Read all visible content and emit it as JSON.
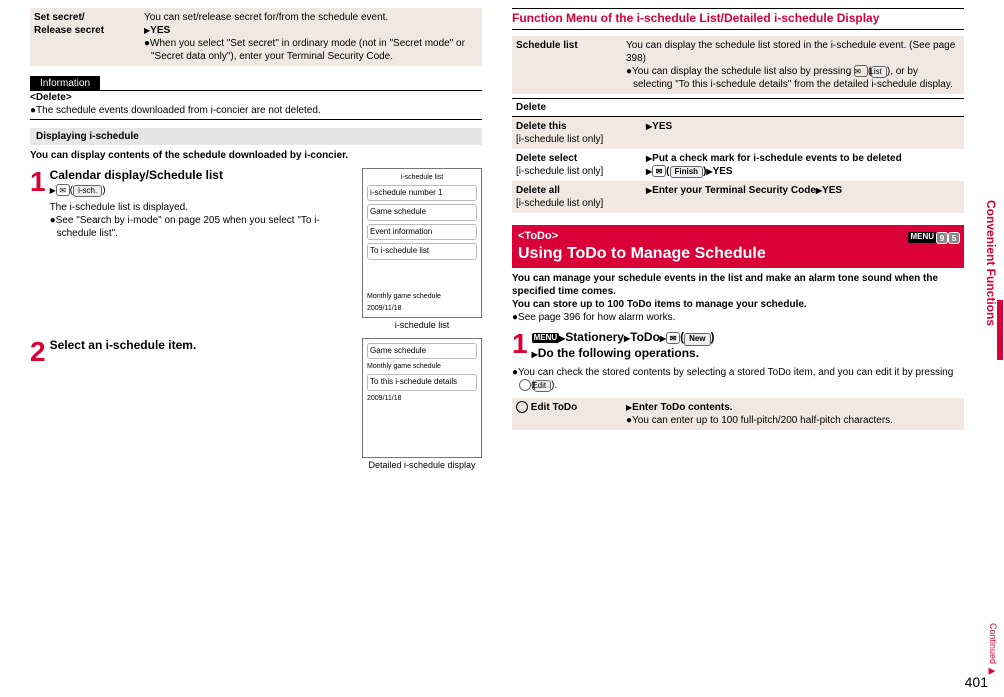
{
  "left": {
    "setSecret": {
      "label": "Set secret/\nRelease secret",
      "line1": "You can set/release secret for/from the schedule event.",
      "yes": "YES",
      "line2": "When you select \"Set secret\" in ordinary mode (not in \"Secret mode\" or \"Secret data only\"), enter your Terminal Security Code."
    },
    "infoLabel": "Information",
    "deleteHead": "<Delete>",
    "deleteBody": "The schedule events downloaded from i-concier are not deleted.",
    "dispHead": "Displaying i-schedule",
    "dispIntro": "You can display contents of the schedule downloaded by i-concier.",
    "step1": {
      "title": "Calendar display/Schedule list",
      "iconBtn": "i-sch.",
      "l1": "The i-schedule list is displayed.",
      "l2": "See \"Search by i-mode\" on page 205 when you select \"To i-schedule list\"."
    },
    "phone1": {
      "title": "i-schedule list",
      "r1": "i-schedule number 1",
      "r2": "Game schedule",
      "r3": "Event information",
      "r4": "To i-schedule list",
      "r5": "Monthly game schedule",
      "r6": "2009/11/18"
    },
    "step2": {
      "title": "Select an i-schedule item."
    },
    "phone2": {
      "title": "Detailed i-schedule display",
      "r1": "Game schedule",
      "r2": "Monthly game schedule",
      "r3": "To this i-schedule details",
      "r4": "2009/11/18"
    }
  },
  "right": {
    "funcHead": "Function Menu of the i-schedule List/Detailed i-schedule Display",
    "schedList": {
      "label": "Schedule list",
      "l1": "You can display the schedule list stored in the i-schedule event. (See page 398)",
      "l2": "You can display the schedule list also by pressing",
      "btn": "List",
      "l3": ", or by selecting \"To this i-schedule details\" from the detailed i-schedule display."
    },
    "delHead": "Delete",
    "del1": {
      "label": "Delete this",
      "sub": "[i-schedule list only]",
      "val": "YES"
    },
    "del2": {
      "label": "Delete select",
      "sub": "[i-schedule list only]",
      "val1": "Put a check mark for i-schedule events to be deleted",
      "btn": "Finish",
      "val2": "YES"
    },
    "del3": {
      "label": "Delete all",
      "sub": "[i-schedule list only]",
      "val": "Enter your Terminal Security Code",
      "val2": "YES"
    },
    "todo": {
      "tag": "<ToDo>",
      "menu": "MENU",
      "code1": "9",
      "code2": "5",
      "title": "Using ToDo to Manage Schedule",
      "p1": "You can manage your schedule events in the list and make an alarm tone sound when the specified time comes.",
      "p2": "You can store up to 100 ToDo items to manage your schedule.",
      "p3": "See page 396 for how alarm works.",
      "step": {
        "menu": "MENU",
        "t1": "Stationery",
        "t2": "ToDo",
        "btn": "New",
        "t3": "Do the following operations.",
        "l1": "You can check the stored contents by selecting a stored ToDo item, and you can edit it by pressing",
        "btn2": "Edit"
      },
      "edit": {
        "label": "Edit ToDo",
        "v1": "Enter ToDo contents.",
        "v2": "You can enter up to 100 full-pitch/200 half-pitch characters."
      }
    }
  },
  "sidebar": "Convenient Functions",
  "continued": "Continued",
  "page": "401"
}
